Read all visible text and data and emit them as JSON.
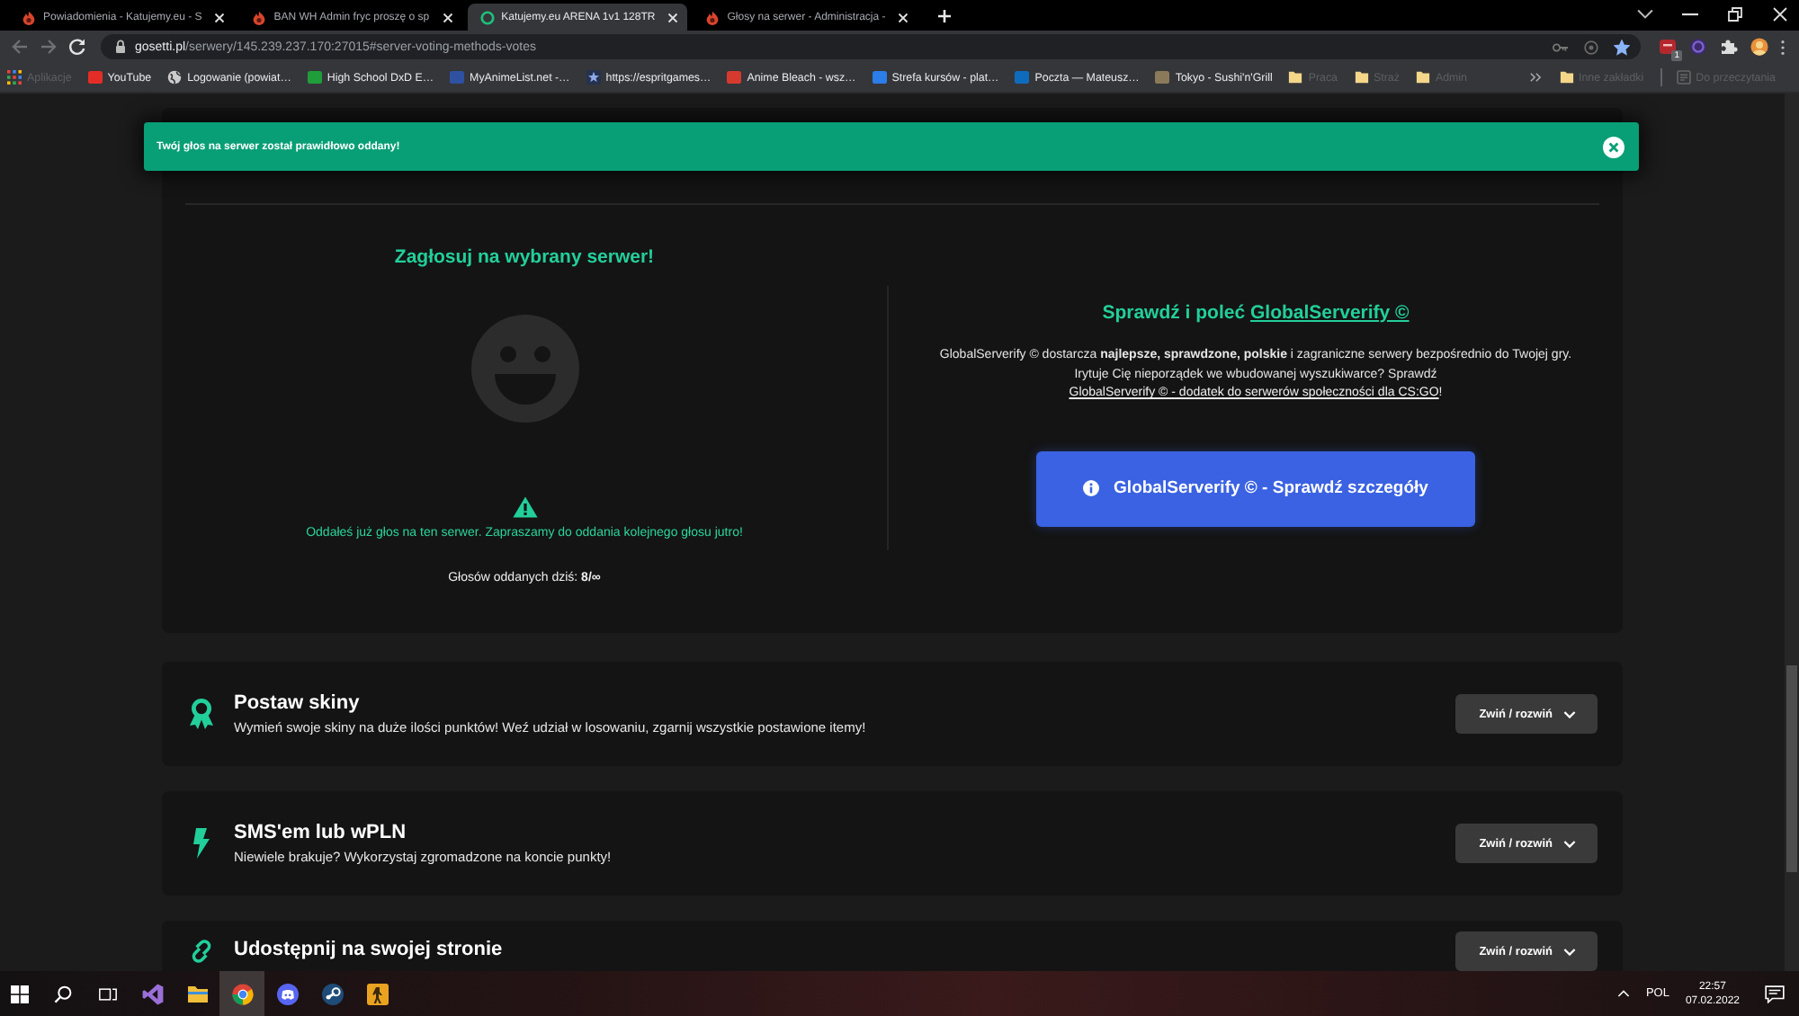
{
  "browser": {
    "tabs": [
      {
        "title": "Powiadomienia - Katujemy.eu - S",
        "kind": "site",
        "selected": false
      },
      {
        "title": "BAN WH Admin fryc proszę o sp",
        "kind": "site",
        "selected": false
      },
      {
        "title": "Katujemy.eu ARENA 1v1 128TR",
        "kind": "ring",
        "selected": true
      },
      {
        "title": "Głosy na serwer - Administracja -",
        "kind": "site",
        "selected": false
      }
    ],
    "back_disabled": true,
    "forward_disabled": true,
    "address": {
      "host": "gosetti.pl",
      "path": "/serwery/145.239.237.170:27015#server-voting-methods-votes"
    },
    "bookmarked": true,
    "extension_badge": "1",
    "bookmarks": [
      {
        "label": "Aplikacje",
        "kind": "apps",
        "dim": true
      },
      {
        "label": "YouTube",
        "kind": "site",
        "color": "#e52d27",
        "dim": false
      },
      {
        "label": "Logowanie (powiat…",
        "kind": "globe",
        "dim": false
      },
      {
        "label": "High School DxD E…",
        "kind": "site",
        "color": "#1f9d3a",
        "dim": false
      },
      {
        "label": "MyAnimeList.net -…",
        "kind": "site",
        "color": "#2e51a2",
        "dim": false
      },
      {
        "label": "https://espritgames…",
        "kind": "star",
        "dim": false
      },
      {
        "label": "Anime Bleach - wsz…",
        "kind": "site",
        "color": "#d63a2f",
        "dim": false
      },
      {
        "label": "Strefa kursów - plat…",
        "kind": "site",
        "color": "#2b7de9",
        "dim": false
      },
      {
        "label": "Poczta — Mateusz…",
        "kind": "site",
        "color": "#0f6cbd",
        "dim": false
      },
      {
        "label": "Tokyo - Sushi'n'Grill",
        "kind": "site",
        "color": "#8a7a5a",
        "dim": false
      },
      {
        "label": "Praca",
        "kind": "folder",
        "dim": true
      },
      {
        "label": "Straż",
        "kind": "folder",
        "dim": true
      },
      {
        "label": "Admin",
        "kind": "folder",
        "dim": true
      }
    ],
    "other_bookmarks": [
      {
        "label": "Inne zakładki",
        "kind": "folder",
        "dim": true
      },
      {
        "label": "Do przeczytania",
        "kind": "reading",
        "dim": true
      }
    ]
  },
  "alert": {
    "message": "Twój głos na serwer został prawidłowo oddany!"
  },
  "vote": {
    "heading": "Zagłosuj na wybrany serwer!",
    "notice": "Oddałeś już głos na ten serwer. Zapraszamy do oddania kolejnego głosu jutro!",
    "votes": "Głosów oddanych dziś: **8/∞**"
  },
  "promo": {
    "heading": "Sprawdź i poleć",
    "heading_link": "GlobalServerify ©",
    "text": "GlobalServerify © dostarcza **najlepsze, sprawdzone, polskie** i zagraniczne serwery bezpośrednio do Twojej gry. Irytuje Cię nieporządek we wbudowanej wyszukiwarce? Sprawdź",
    "link": "GlobalServerify © - dodatek do serwerów społeczności dla CS:GO",
    "text_after": "!",
    "button": "GlobalServerify © - Sprawdź szczegóły"
  },
  "sections": [
    {
      "kind": "award",
      "title": "Postaw skiny",
      "subtitle": "Wymień swoje skiny na duże ilości punktów! Weź udział w losowaniu, zgarnij wszystkie postawione itemy!",
      "button": "Zwiń / rozwiń"
    },
    {
      "kind": "bolt",
      "title": "SMS'em lub wPLN",
      "subtitle": "Niewiele brakuje? Wykorzystaj zgromadzone na koncie punkty!",
      "button": "Zwiń / rozwiń"
    },
    {
      "kind": "link",
      "title": "Udostępnij na swojej stronie",
      "button": "Zwiń / rozwiń"
    }
  ],
  "taskbar": {
    "apps": [
      {
        "kind": "ribbon",
        "selected": false
      },
      {
        "kind": "folder",
        "selected": false
      },
      {
        "kind": "browser",
        "selected": true
      },
      {
        "kind": "chat",
        "selected": false
      },
      {
        "kind": "steam",
        "selected": false
      },
      {
        "kind": "game",
        "selected": false
      }
    ],
    "language": "POL",
    "time": "22:57",
    "date": "07.02.2022"
  }
}
